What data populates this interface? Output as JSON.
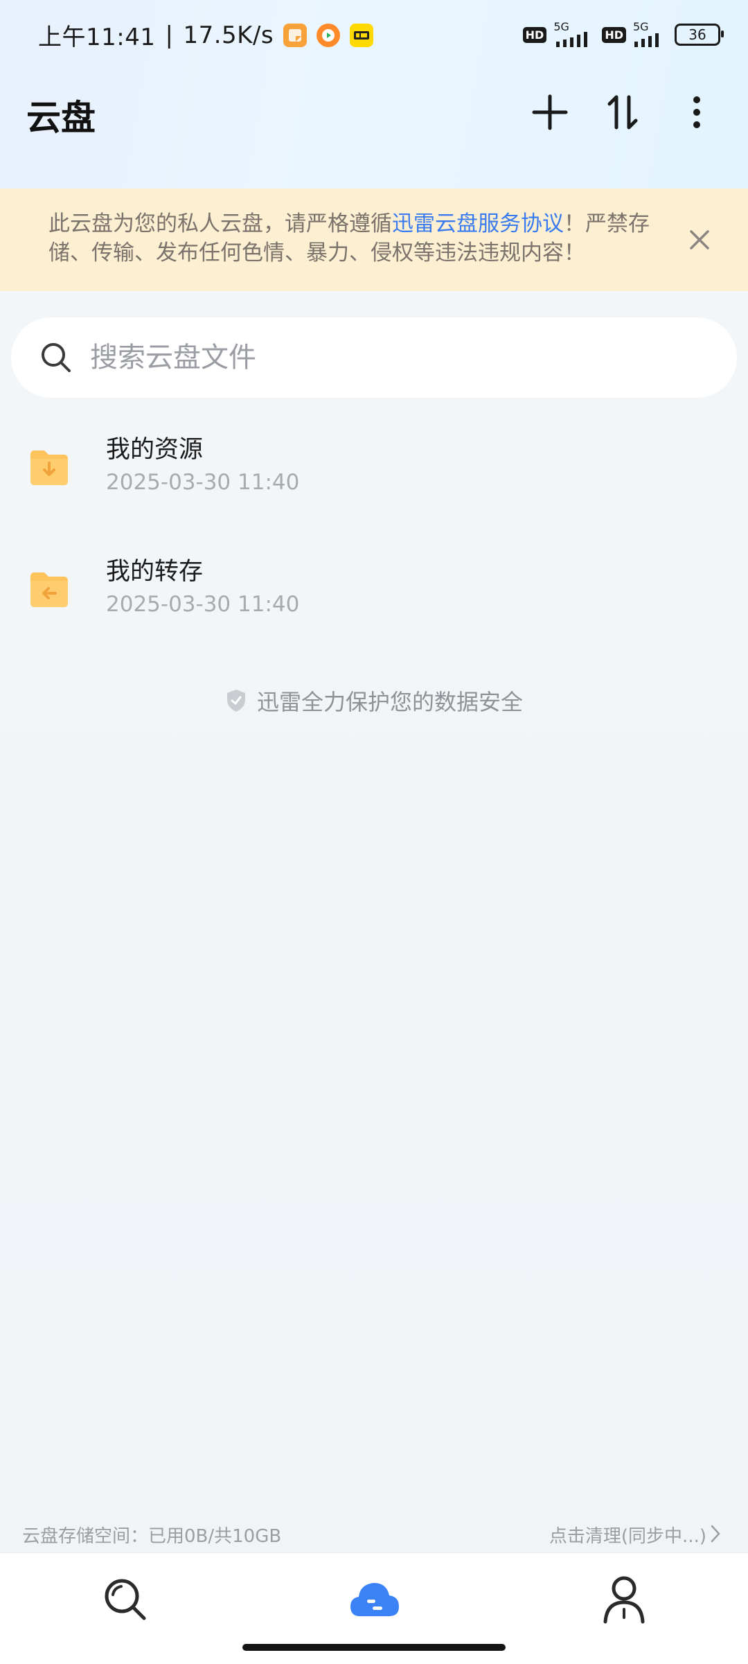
{
  "status_bar": {
    "time": "上午11:41",
    "separator": "|",
    "speed": "17.5K/s",
    "hd1": "HD",
    "net1": "5G",
    "hd2": "HD",
    "net2": "5G",
    "battery": "36"
  },
  "header": {
    "title": "云盘"
  },
  "notice": {
    "text_before": "此云盘为您的私人云盘，请严格遵循",
    "link": "迅雷云盘服务协议",
    "text_after": "！严禁存储、传输、发布任何色情、暴力、侵权等违法违规内容！"
  },
  "search": {
    "placeholder": "搜索云盘文件"
  },
  "files": [
    {
      "name": "我的资源",
      "date": "2025-03-30 11:40"
    },
    {
      "name": "我的转存",
      "date": "2025-03-30 11:40"
    }
  ],
  "security_text": "迅雷全力保护您的数据安全",
  "storage": {
    "usage": "云盘存储空间：已用0B/共10GB",
    "action": "点击清理(同步中...)"
  },
  "colors": {
    "accent": "#3a7bf0",
    "notice_bg": "#fdefd2",
    "folder": "#fdc35c",
    "nav_active": "#3b82f6"
  }
}
